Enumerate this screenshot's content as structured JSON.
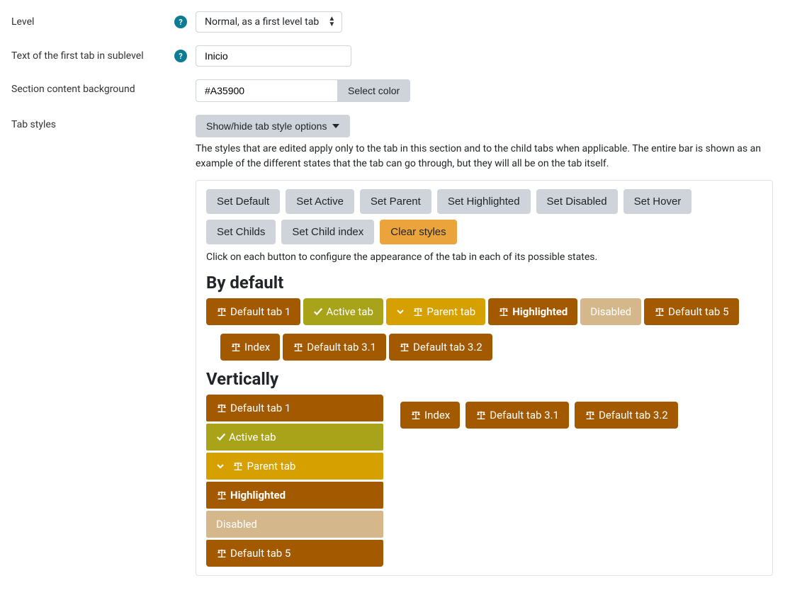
{
  "fields": {
    "level": {
      "label": "Level",
      "value": "Normal, as a first level tab"
    },
    "first_tab_text": {
      "label": "Text of the first tab in sublevel",
      "value": "Inicio"
    },
    "section_bg": {
      "label": "Section content background",
      "value": "#A35900",
      "button": "Select color"
    },
    "tab_styles": {
      "label": "Tab styles",
      "toggle": "Show/hide tab style options",
      "help": "The styles that are edited apply only to the tab in this section and to the child tabs when applicable. The entire bar is shown as an example of the different states that the tab can go through, but they will all be on the tab itself."
    }
  },
  "style_buttons": [
    "Set Default",
    "Set Active",
    "Set Parent",
    "Set Highlighted",
    "Set Disabled",
    "Set Hover",
    "Set Childs",
    "Set Child index"
  ],
  "clear_button": "Clear styles",
  "style_note": "Click on each button to configure the appearance of the tab in each of its possible states.",
  "preview": {
    "by_default_heading": "By default",
    "vertically_heading": "Vertically",
    "tabs_main": [
      {
        "label": "Default tab 1",
        "style": "default",
        "icon": "scale"
      },
      {
        "label": "Active tab",
        "style": "active",
        "icon": "check"
      },
      {
        "label": "Parent tab",
        "style": "parent",
        "icon": "scale",
        "chevron": true
      },
      {
        "label": "Highlighted",
        "style": "highlighted",
        "icon": "scale"
      },
      {
        "label": "Disabled",
        "style": "disabled",
        "icon": null
      },
      {
        "label": "Default tab 5",
        "style": "default",
        "icon": "scale"
      }
    ],
    "tabs_sub": [
      {
        "label": "Index",
        "style": "default",
        "icon": "scale"
      },
      {
        "label": "Default tab 3.1",
        "style": "default",
        "icon": "scale"
      },
      {
        "label": "Default tab 3.2",
        "style": "default",
        "icon": "scale"
      }
    ]
  }
}
